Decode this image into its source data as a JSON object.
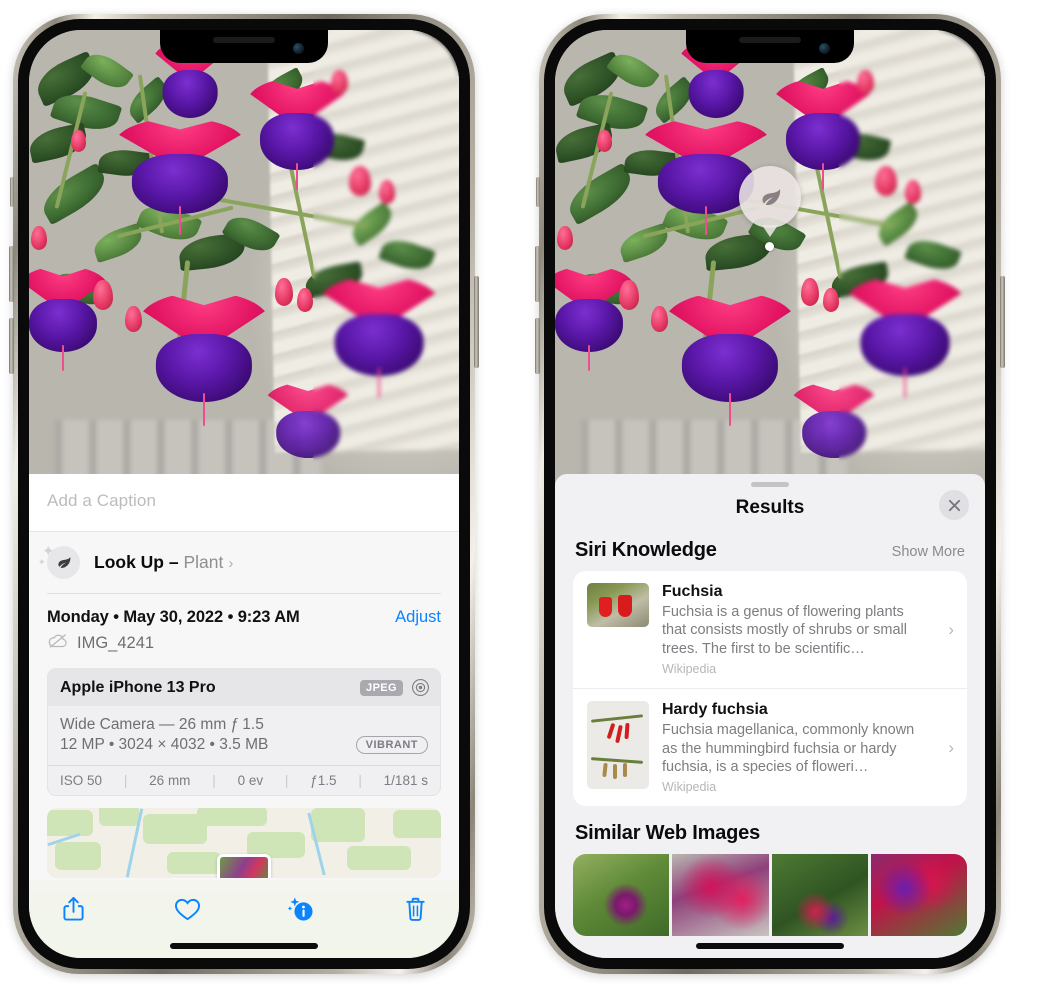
{
  "left_phone": {
    "caption": {
      "placeholder": "Add a Caption",
      "value": ""
    },
    "lookup": {
      "label": "Look Up – ",
      "subject": "Plant",
      "chevron": "›",
      "icon": "leaf-icon"
    },
    "meta": {
      "date": "Monday • May 30, 2022 • 9:23 AM",
      "adjust": "Adjust",
      "filename": "IMG_4241",
      "cloud_icon": "icloud-slash-icon"
    },
    "exif": {
      "device": "Apple iPhone 13 Pro",
      "format_badge": "JPEG",
      "aperture_icon": "aperture-icon",
      "lens_line": "Wide Camera — 26 mm ƒ 1.5",
      "size_line": "12 MP • 3024 × 4032 • 3.5 MB",
      "style_badge": "VIBRANT",
      "stats": [
        "ISO 50",
        "26 mm",
        "0 ev",
        "ƒ1.5",
        "1/181 s"
      ]
    },
    "toolbar": {
      "share": "share-icon",
      "favorite": "heart-icon",
      "info": "info-sparkle-icon",
      "delete": "trash-icon"
    }
  },
  "right_phone": {
    "badge": {
      "icon": "leaf-icon"
    },
    "sheet": {
      "title": "Results",
      "close": "✕",
      "sections": [
        {
          "title": "Siri Knowledge",
          "action": "Show More"
        },
        {
          "title": "Similar Web Images",
          "action": ""
        }
      ],
      "knowledge_cards": [
        {
          "title": "Fuchsia",
          "description": "Fuchsia is a genus of flowering plants that consists mostly of shrubs or small trees. The first to be scientific…",
          "source": "Wikipedia",
          "chevron": "›"
        },
        {
          "title": "Hardy fuchsia",
          "description": "Fuchsia magellanica, commonly known as the hummingbird fuchsia or hardy fuchsia, is a species of floweri…",
          "source": "Wikipedia",
          "chevron": "›"
        }
      ],
      "web_images_count": 4
    }
  },
  "colors": {
    "accent_blue": "#0a84ff",
    "sheet_bg": "#f1f1f4",
    "card_bg": "#ffffff",
    "secondary_text": "#8e8e93"
  }
}
